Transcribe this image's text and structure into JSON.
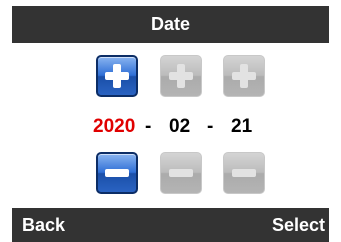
{
  "header": {
    "title": "Date"
  },
  "date": {
    "year": "2020",
    "month": "02",
    "day": "21",
    "separator": "-",
    "selected_field": "year"
  },
  "colors": {
    "selected_field_text": "#e00000",
    "bar_background": "#333333",
    "active_button": "#2f6fd6",
    "disabled_button": "#bcbcbc"
  },
  "footer": {
    "left_softkey": "Back",
    "right_softkey": "Select"
  },
  "icons": {
    "increment": "plus-icon",
    "decrement": "minus-icon"
  }
}
